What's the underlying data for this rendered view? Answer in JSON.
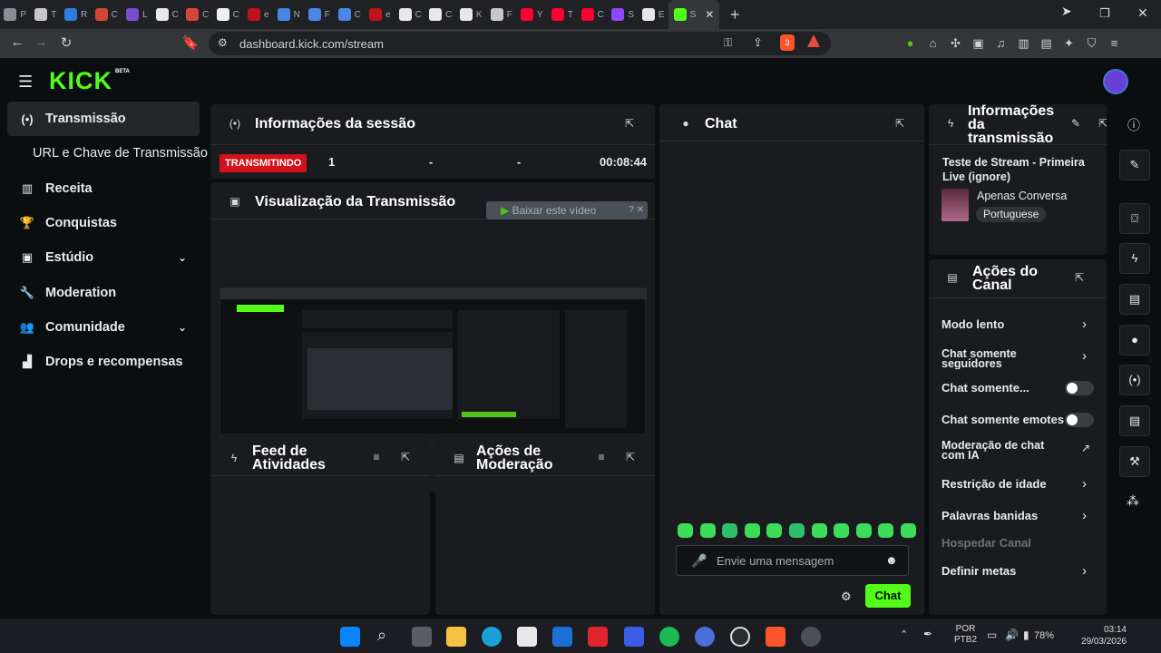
{
  "browser": {
    "tabs": [
      {
        "label": "P",
        "color": "#8a8f96"
      },
      {
        "label": "T",
        "color": "#c8c8c8"
      },
      {
        "label": "R",
        "color": "#2f7ce0"
      },
      {
        "label": "C",
        "color": "#d44638"
      },
      {
        "label": "L",
        "color": "#7a4ccf"
      },
      {
        "label": "C",
        "color": "#e8e8e8"
      },
      {
        "label": "C",
        "color": "#d44638"
      },
      {
        "label": "C",
        "color": "#f0f0f0"
      },
      {
        "label": "e",
        "color": "#c0121b"
      },
      {
        "label": "N",
        "color": "#4a86e8"
      },
      {
        "label": "F",
        "color": "#4a86e8"
      },
      {
        "label": "C",
        "color": "#4a86e8"
      },
      {
        "label": "e",
        "color": "#c0121b"
      },
      {
        "label": "C",
        "color": "#e8e8e8"
      },
      {
        "label": "C",
        "color": "#e8e8e8"
      },
      {
        "label": "K",
        "color": "#e8e8e8"
      },
      {
        "label": "F",
        "color": "#c8c8c8"
      },
      {
        "label": "Y",
        "color": "#ff0033"
      },
      {
        "label": "T",
        "color": "#ff0033"
      },
      {
        "label": "C",
        "color": "#ff0033"
      },
      {
        "label": "S",
        "color": "#9146ff"
      },
      {
        "label": "E",
        "color": "#e8e8e8"
      }
    ],
    "active_tab": {
      "label": "S"
    },
    "url": "dashboard.kick.com/stream",
    "shield_badge": "3"
  },
  "app": {
    "logo": "KICK",
    "logo_badge": "BETA",
    "colors": {
      "accent": "#53fc18",
      "live": "#d3111a"
    }
  },
  "sidebar": {
    "items": [
      {
        "label": "Transmissão",
        "icon": "broadcast-icon",
        "active": true
      },
      {
        "label": "URL e Chave de Transmissão",
        "icon": "",
        "sub": true
      },
      {
        "label": "Receita",
        "icon": "revenue-icon"
      },
      {
        "label": "Conquistas",
        "icon": "trophy-icon"
      },
      {
        "label": "Estúdio",
        "icon": "studio-icon",
        "expand": true
      },
      {
        "label": "Moderation",
        "icon": "wrench-icon"
      },
      {
        "label": "Comunidade",
        "icon": "community-icon",
        "expand": true
      },
      {
        "label": "Drops e recompensas",
        "icon": "drops-icon"
      }
    ]
  },
  "session": {
    "title": "Informações da sessão",
    "status": "TRANSMITINDO",
    "viewers": "1",
    "stat2": "-",
    "stat3": "-",
    "duration": "00:08:44"
  },
  "preview": {
    "title": "Visualização da Transmissão",
    "download_overlay": "Baixar este vídeo"
  },
  "feed": {
    "title": "Feed de Atividades"
  },
  "mod_actions": {
    "title": "Ações de Moderação"
  },
  "chat": {
    "title": "Chat",
    "placeholder": "Envie uma mensagem",
    "send_label": "Chat"
  },
  "stream_info": {
    "title": "Informações da transmissão",
    "stream_title": "Teste de Stream - Primeira Live (ignore)",
    "category": "Apenas Conversa",
    "language": "Portuguese"
  },
  "channel_actions": {
    "title": "Ações do Canal",
    "items": [
      {
        "label": "Modo lento",
        "control": "chevron"
      },
      {
        "label": "Chat somente seguidores",
        "control": "chevron"
      },
      {
        "label": "Chat somente...",
        "control": "toggle"
      },
      {
        "label": "Chat somente emotes",
        "control": "toggle"
      },
      {
        "label": "Moderação de chat com IA",
        "control": "external"
      },
      {
        "label": "Restrição de idade",
        "control": "chevron"
      },
      {
        "label": "Palavras banidas",
        "control": "chevron"
      },
      {
        "label": "Hospedar Canal",
        "control": "none",
        "disabled": true
      },
      {
        "label": "Definir metas",
        "control": "chevron"
      }
    ]
  },
  "taskbar": {
    "lang1": "POR",
    "lang2": "PTB2",
    "battery": "78%",
    "time": "03:14",
    "date": "29/03/2026"
  }
}
